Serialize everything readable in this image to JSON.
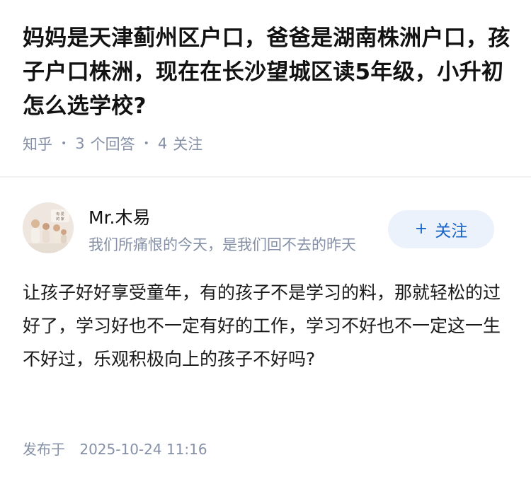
{
  "question": {
    "title": "妈妈是天津蓟州区户口，爸爸是湖南株洲户口，孩子户口株洲，现在在长沙望城区读5年级，小升初怎么选学校?",
    "source": "知乎",
    "answer_count": "3",
    "answer_label": "个回答",
    "follow_count": "4",
    "follow_label": "关注"
  },
  "author": {
    "name": "Mr.木易",
    "bio": "我们所痛恨的今天，是我们回不去的昨天",
    "follow_button_label": "关注",
    "avatar_icon": "family-photo-avatar"
  },
  "answer": {
    "content": "让孩子好好享受童年，有的孩子不是学习的料，那就轻松的过好了，学习好也不一定有好的工作，学习不好也不一定这一生不好过，乐观积极向上的孩子不好吗?",
    "publish_label": "发布于",
    "publish_time": "2025-10-24 11:16"
  },
  "colors": {
    "meta_gray": "#8590a6",
    "accent_blue": "#1763c7",
    "follow_bg": "#ebf2fb"
  }
}
